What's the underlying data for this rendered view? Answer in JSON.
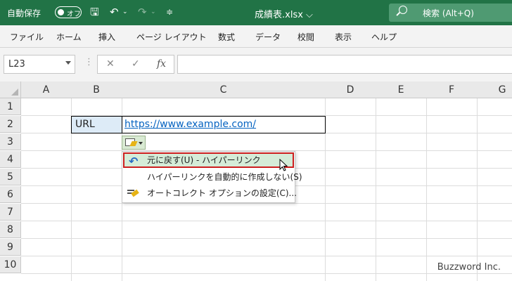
{
  "titlebar": {
    "autosave_label": "自動保存",
    "autosave_state": "オフ",
    "filename": "成績表.xlsx ⌵",
    "search_placeholder": "検索 (Alt+Q)"
  },
  "ribbon": {
    "tabs": [
      "ファイル",
      "ホーム",
      "挿入",
      "ページ レイアウト",
      "数式",
      "データ",
      "校閲",
      "表示",
      "ヘルプ"
    ]
  },
  "formula_bar": {
    "name_box": "L23",
    "cancel_icon": "✕",
    "enter_icon": "✓",
    "fx_label": "fx",
    "formula": ""
  },
  "sheet": {
    "columns": [
      "A",
      "B",
      "C",
      "D",
      "E",
      "F",
      "G"
    ],
    "rows": [
      "1",
      "2",
      "3",
      "4",
      "5",
      "6",
      "7",
      "8",
      "9",
      "10"
    ],
    "cells": {
      "B2": "URL",
      "C2": "https://www.example.com/"
    }
  },
  "autocorrect_menu": {
    "items": [
      {
        "label": "元に戻す(U) - ハイパーリンク",
        "icon": "undo-icon",
        "highlighted": true
      },
      {
        "label": "ハイパーリンクを自動的に作成しない(S)",
        "icon": "",
        "highlighted": false
      },
      {
        "label": "オートコレクト オプションの設定(C)...",
        "icon": "autocorrect-options-icon",
        "highlighted": false
      }
    ]
  },
  "watermark": "Buzzword Inc.",
  "colors": {
    "title_bar": "#217346",
    "highlight_border": "#cc1f1f",
    "highlight_fill": "#d5ecd8",
    "hyperlink": "#0563c1",
    "url_cell_fill": "#ddebf7"
  }
}
